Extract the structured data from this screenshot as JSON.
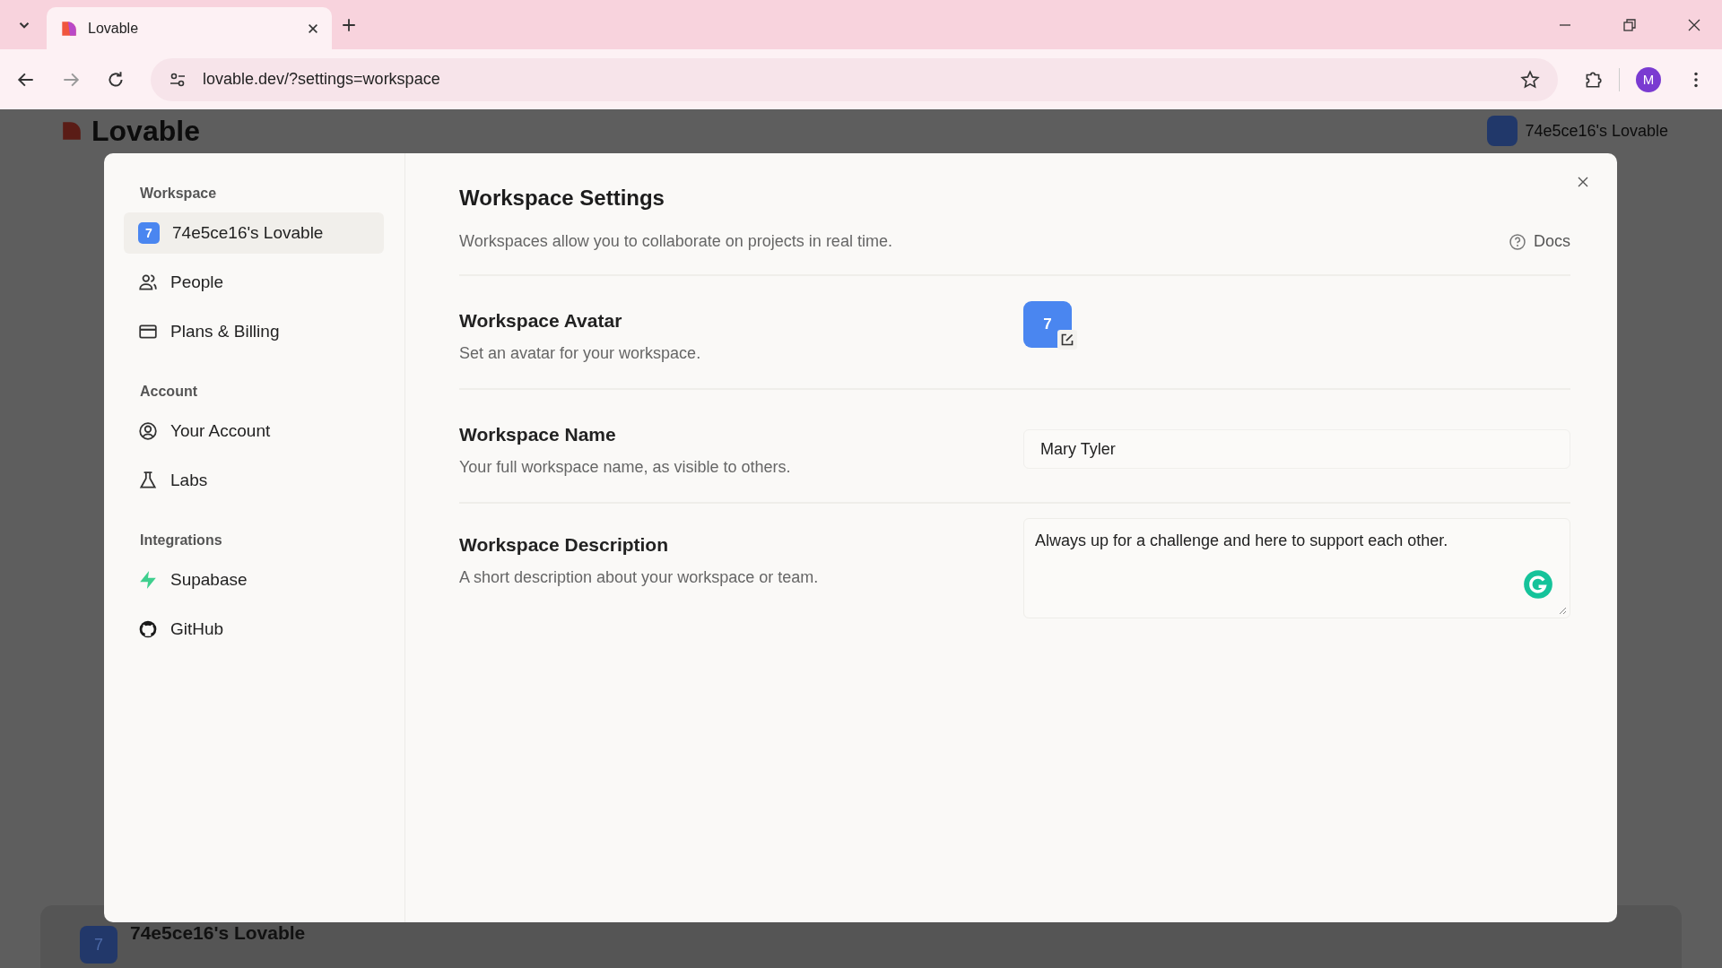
{
  "browser": {
    "tab": {
      "title": "Lovable"
    },
    "url": "lovable.dev/?settings=workspace",
    "profile_initial": "M"
  },
  "background": {
    "logo": "Lovable",
    "workspace_switcher": "74e5ce16's Lovable",
    "card": {
      "avatar_initial": "7",
      "title": "74e5ce16's Lovable"
    }
  },
  "sidebar": {
    "sections": [
      {
        "heading": "Workspace",
        "items": [
          {
            "kind": "avatar",
            "initial": "7",
            "label": "74e5ce16's Lovable",
            "selected": true
          },
          {
            "kind": "people",
            "label": "People",
            "selected": false
          },
          {
            "kind": "billing",
            "label": "Plans & Billing",
            "selected": false
          }
        ]
      },
      {
        "heading": "Account",
        "items": [
          {
            "kind": "account",
            "label": "Your Account",
            "selected": false
          },
          {
            "kind": "labs",
            "label": "Labs",
            "selected": false
          }
        ]
      },
      {
        "heading": "Integrations",
        "items": [
          {
            "kind": "supabase",
            "label": "Supabase",
            "selected": false
          },
          {
            "kind": "github",
            "label": "GitHub",
            "selected": false
          }
        ]
      }
    ]
  },
  "main": {
    "title": "Workspace Settings",
    "subtitle": "Workspaces allow you to collaborate on projects in real time.",
    "docs_link": "Docs",
    "rows": [
      {
        "kind": "avatar",
        "title": "Workspace Avatar",
        "description": "Set an avatar for your workspace.",
        "initial": "7"
      },
      {
        "kind": "text",
        "title": "Workspace Name",
        "description": "Your full workspace name, as visible to others.",
        "value": "Mary Tyler"
      },
      {
        "kind": "textarea",
        "title": "Workspace Description",
        "description": "A short description about your workspace or team.",
        "value": "Always up for a challenge and here to support each other."
      }
    ]
  }
}
